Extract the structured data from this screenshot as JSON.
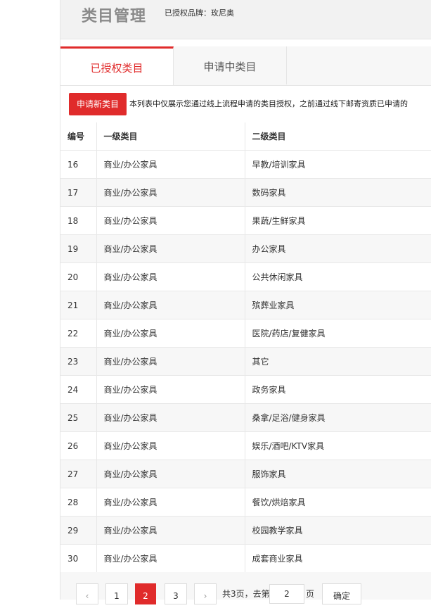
{
  "header": {
    "title": "类目管理",
    "brand_label": "已授权品牌：",
    "brand_name": "玫尼奥"
  },
  "tabs": [
    {
      "label": "已授权类目",
      "active": true
    },
    {
      "label": "申请中类目",
      "active": false
    }
  ],
  "toolbar": {
    "apply_button": "申请新类目",
    "notice": "本列表中仅展示您通过线上流程申请的类目授权，之前通过线下邮寄资质已申请的"
  },
  "table": {
    "headers": [
      "编号",
      "一级类目",
      "二级类目"
    ],
    "rows": [
      [
        "16",
        "商业/办公家具",
        "早教/培训家具"
      ],
      [
        "17",
        "商业/办公家具",
        "数码家具"
      ],
      [
        "18",
        "商业/办公家具",
        "果蔬/生鲜家具"
      ],
      [
        "19",
        "商业/办公家具",
        "办公家具"
      ],
      [
        "20",
        "商业/办公家具",
        "公共休闲家具"
      ],
      [
        "21",
        "商业/办公家具",
        "殡葬业家具"
      ],
      [
        "22",
        "商业/办公家具",
        "医院/药店/复健家具"
      ],
      [
        "23",
        "商业/办公家具",
        "其它"
      ],
      [
        "24",
        "商业/办公家具",
        "政务家具"
      ],
      [
        "25",
        "商业/办公家具",
        "桑拿/足浴/健身家具"
      ],
      [
        "26",
        "商业/办公家具",
        "娱乐/酒吧/KTV家具"
      ],
      [
        "27",
        "商业/办公家具",
        "服饰家具"
      ],
      [
        "28",
        "商业/办公家具",
        "餐饮/烘焙家具"
      ],
      [
        "29",
        "商业/办公家具",
        "校园教学家具"
      ],
      [
        "30",
        "商业/办公家具",
        "成套商业家具"
      ]
    ]
  },
  "pagination": {
    "prev": "‹",
    "pages": [
      "1",
      "2",
      "3"
    ],
    "current": "2",
    "next": "›",
    "total_text": "共3页，去第",
    "goto_value": "2",
    "unit": "页",
    "confirm": "确定"
  },
  "colors": {
    "accent": "#e02b2b"
  }
}
